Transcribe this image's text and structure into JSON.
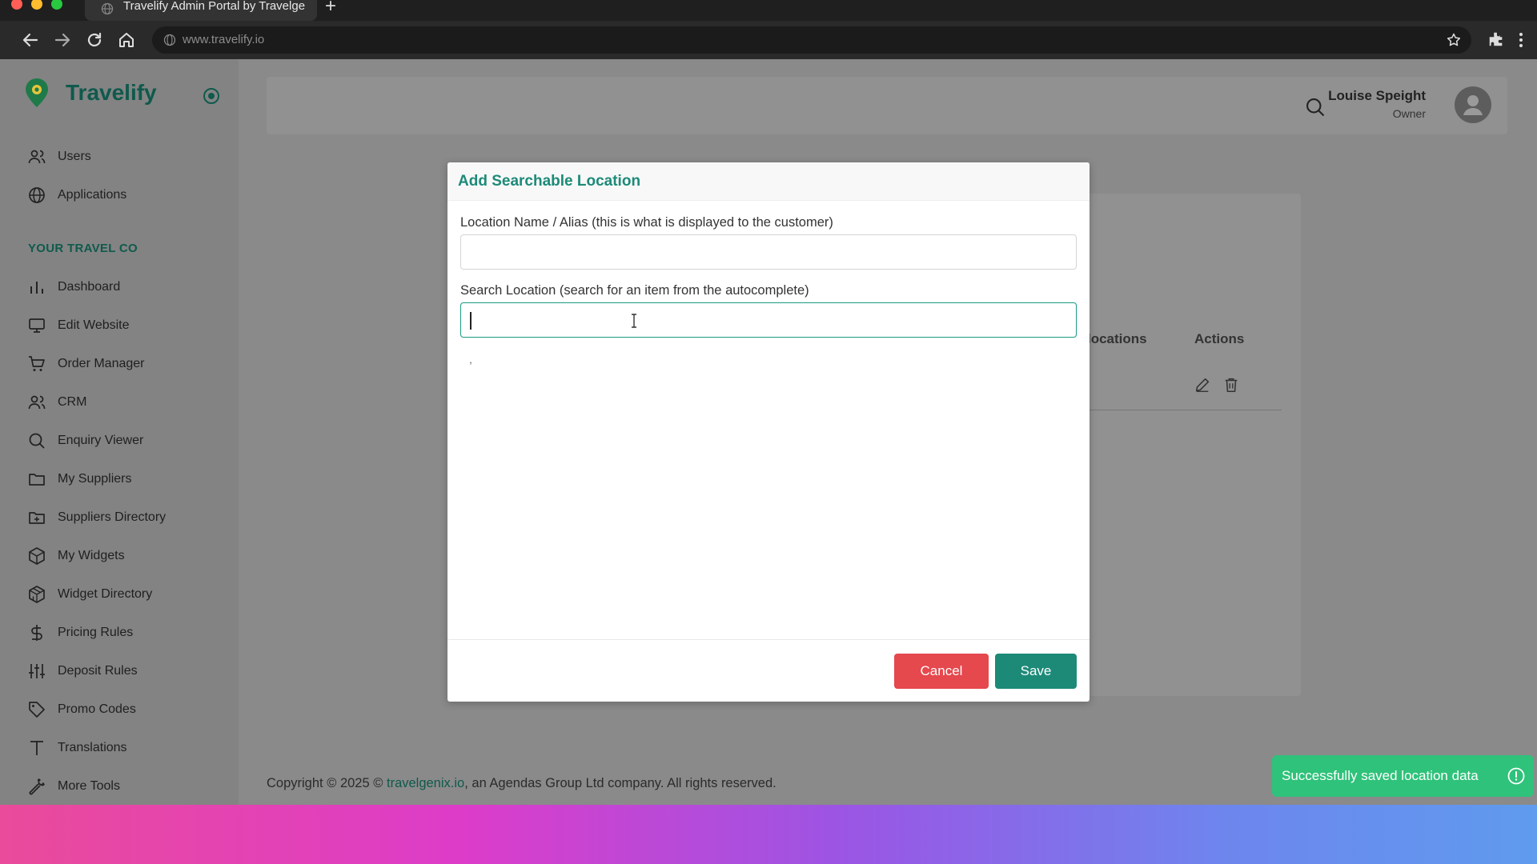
{
  "browser": {
    "tab_title": "Travelify Admin Portal by Travelge",
    "url": "www.travelify.io"
  },
  "sidebar": {
    "brand": "Travelify",
    "top_items": [
      {
        "label": "Users",
        "icon": "users-icon"
      },
      {
        "label": "Applications",
        "icon": "globe-icon"
      }
    ],
    "section_label": "YOUR TRAVEL CO",
    "items": [
      {
        "label": "Dashboard",
        "icon": "bar-chart-icon"
      },
      {
        "label": "Edit Website",
        "icon": "monitor-icon"
      },
      {
        "label": "Order Manager",
        "icon": "cart-icon"
      },
      {
        "label": "CRM",
        "icon": "users-icon"
      },
      {
        "label": "Enquiry Viewer",
        "icon": "search-icon"
      },
      {
        "label": "My Suppliers",
        "icon": "folder-icon"
      },
      {
        "label": "Suppliers Directory",
        "icon": "folder-plus-icon"
      },
      {
        "label": "My Widgets",
        "icon": "cube-icon"
      },
      {
        "label": "Widget Directory",
        "icon": "cubes-icon"
      },
      {
        "label": "Pricing Rules",
        "icon": "dollar-icon"
      },
      {
        "label": "Deposit Rules",
        "icon": "sliders-icon"
      },
      {
        "label": "Promo Codes",
        "icon": "tag-icon"
      },
      {
        "label": "Translations",
        "icon": "text-icon"
      },
      {
        "label": "More Tools",
        "icon": "wrench-icon"
      }
    ]
  },
  "header": {
    "user_name": "Louise Speight",
    "user_role": "Owner"
  },
  "background_table": {
    "col_locations": "locations",
    "col_actions": "Actions"
  },
  "modal": {
    "title": "Add Searchable Location",
    "name_label": "Location Name / Alias (this is what is displayed to the customer)",
    "name_value": "",
    "search_label": "Search Location (search for an item from the autocomplete)",
    "search_value": "",
    "stray_text": ",",
    "cancel_label": "Cancel",
    "save_label": "Save"
  },
  "footer": {
    "prefix": "Copyright © 2025 © ",
    "link": "travelgenix.io",
    "suffix": ", an Agendas Group Ltd company. All rights reserved."
  },
  "toast": {
    "message": "Successfully saved location data"
  },
  "colors": {
    "brand": "#0f5a4c",
    "accent": "#1d8a78",
    "danger": "#e5484d",
    "success": "#2fc27a"
  }
}
